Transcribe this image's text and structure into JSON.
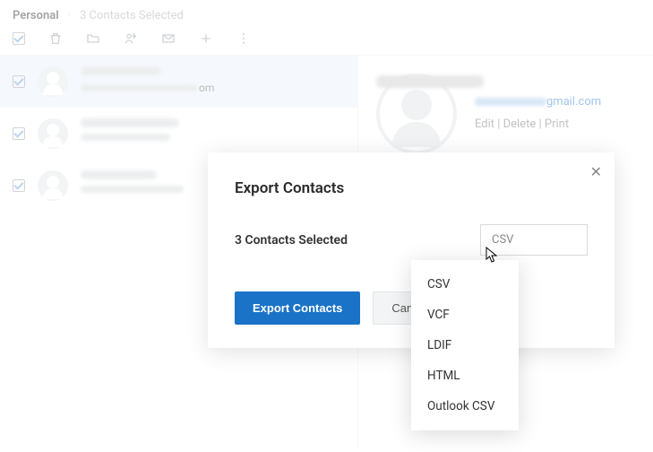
{
  "header": {
    "title": "Personal",
    "separator": "·",
    "selection_text": "3 Contacts Selected"
  },
  "contacts": [
    {
      "email_suffix": "om"
    },
    {
      "email_suffix": ""
    },
    {
      "email_suffix": ""
    }
  ],
  "detail": {
    "email_visible_suffix": "gmail.com",
    "actions_text": "Edit | Delete | Print"
  },
  "modal": {
    "title": "Export Contacts",
    "selection_label": "3 Contacts Selected",
    "select_value": "CSV",
    "export_button": "Export Contacts",
    "cancel_button": "Cancel"
  },
  "dropdown": {
    "options": [
      "CSV",
      "VCF",
      "LDIF",
      "HTML",
      "Outlook CSV"
    ]
  }
}
